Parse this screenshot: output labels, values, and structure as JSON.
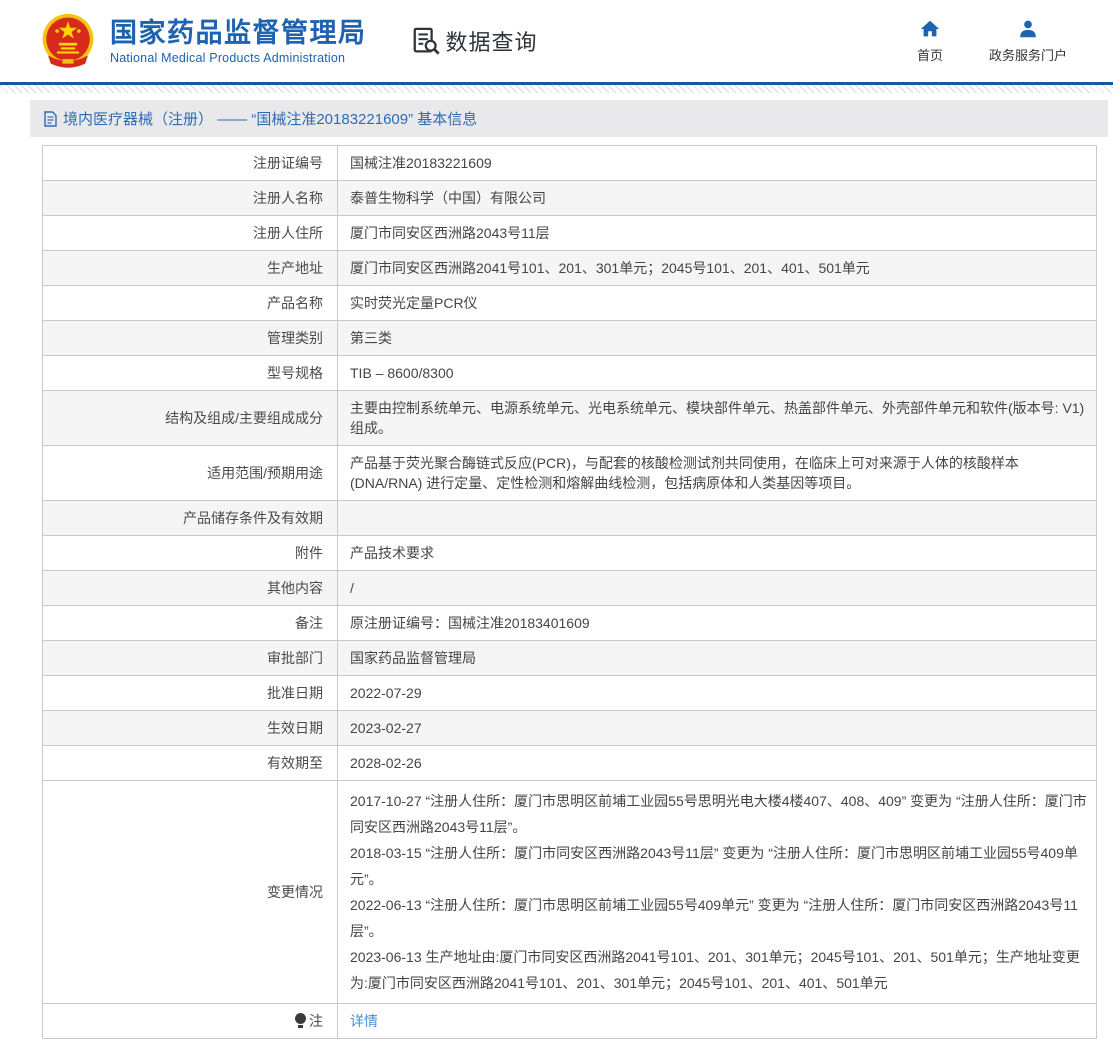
{
  "header": {
    "org_name_zh": "国家药品监督管理局",
    "org_name_en": "National Medical Products Administration",
    "query_label": "数据查询",
    "nav": [
      {
        "label": "首页",
        "icon": "home-icon"
      },
      {
        "label": "政务服务门户",
        "icon": "user-icon"
      }
    ]
  },
  "breadcrumb": {
    "title": "境内医疗器械（注册） —— “国械注准20183221609” 基本信息"
  },
  "table": {
    "rows": [
      {
        "label": "注册证编号",
        "value": "国械注准20183221609",
        "shaded": false
      },
      {
        "label": "注册人名称",
        "value": "泰普生物科学（中国）有限公司",
        "shaded": true
      },
      {
        "label": "注册人住所",
        "value": "厦门市同安区西洲路2043号11层",
        "shaded": false
      },
      {
        "label": "生产地址",
        "value": "厦门市同安区西洲路2041号101、201、301单元；2045号101、201、401、501单元",
        "shaded": true
      },
      {
        "label": "产品名称",
        "value": "实时荧光定量PCR仪",
        "shaded": false
      },
      {
        "label": "管理类别",
        "value": "第三类",
        "shaded": true
      },
      {
        "label": "型号规格",
        "value": "TIB – 8600/8300",
        "shaded": false
      },
      {
        "label": "结构及组成/主要组成成分",
        "value": "主要由控制系统单元、电源系统单元、光电系统单元、模块部件单元、热盖部件单元、外壳部件单元和软件(版本号: V1)组成。",
        "shaded": true
      },
      {
        "label": "适用范围/预期用途",
        "value": "产品基于荧光聚合酶链式反应(PCR)，与配套的核酸检测试剂共同使用，在临床上可对来源于人体的核酸样本(DNA/RNA) 进行定量、定性检测和熔解曲线检测，包括病原体和人类基因等项目。",
        "shaded": false
      },
      {
        "label": "产品储存条件及有效期",
        "value": "",
        "shaded": true
      },
      {
        "label": "附件",
        "value": "产品技术要求",
        "shaded": false
      },
      {
        "label": "其他内容",
        "value": "/",
        "shaded": true
      },
      {
        "label": "备注",
        "value": "原注册证编号：国械注准20183401609",
        "shaded": false
      },
      {
        "label": "审批部门",
        "value": "国家药品监督管理局",
        "shaded": true
      },
      {
        "label": "批准日期",
        "value": "2022-07-29",
        "shaded": false
      },
      {
        "label": "生效日期",
        "value": "2023-02-27",
        "shaded": true
      },
      {
        "label": "有效期至",
        "value": "2028-02-26",
        "shaded": false
      },
      {
        "label": "变更情况",
        "shaded": false,
        "value": [
          "2017-10-27 “注册人住所：厦门市思明区前埔工业园55号思明光电大楼4楼407、408、409” 变更为 “注册人住所：厦门市同安区西洲路2043号11层”。",
          "2018-03-15 “注册人住所：厦门市同安区西洲路2043号11层” 变更为 “注册人住所：厦门市思明区前埔工业园55号409单元”。",
          "2022-06-13  “注册人住所：厦门市思明区前埔工业园55号409单元” 变更为 “注册人住所：厦门市同安区西洲路2043号11层”。",
          "2023-06-13 生产地址由:厦门市同安区西洲路2041号101、201、301单元；2045号101、201、501单元；生产地址变更为:厦门市同安区西洲路2041号101、201、301单元；2045号101、201、401、501单元"
        ]
      },
      {
        "label": "注",
        "label_icon": "bulb-icon",
        "value": "详情",
        "link": true,
        "shaded": false
      }
    ]
  },
  "colors": {
    "accent": "#1e63b0",
    "header-rule": "#1558a6",
    "breadcrumb-text": "#2f6bb3",
    "link": "#4a90d9",
    "panel-head-bg": "#e9e9ec",
    "row-alt-bg": "#f5f5f6",
    "table-border": "#c9c9c9",
    "table-outer-border": "#a9a9ad",
    "text": "#454545"
  }
}
